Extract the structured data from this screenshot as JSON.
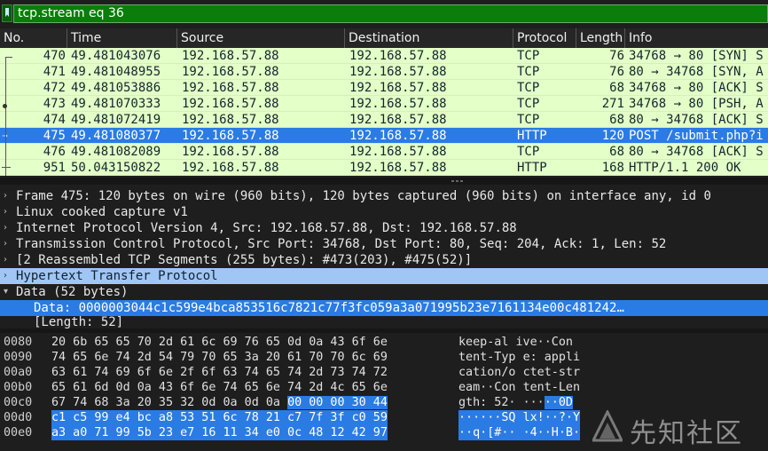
{
  "filter": {
    "value": "tcp.stream eq 36"
  },
  "columns": [
    "No.",
    "Time",
    "Source",
    "Destination",
    "Protocol",
    "Length",
    "Info"
  ],
  "packets": [
    {
      "no": "470",
      "time": "49.481043076",
      "src": "192.168.57.88",
      "dst": "192.168.57.88",
      "proto": "TCP",
      "len": "76",
      "info": "34768 → 80 [SYN] S"
    },
    {
      "no": "471",
      "time": "49.481048955",
      "src": "192.168.57.88",
      "dst": "192.168.57.88",
      "proto": "TCP",
      "len": "76",
      "info": "80 → 34768 [SYN, A"
    },
    {
      "no": "472",
      "time": "49.481053886",
      "src": "192.168.57.88",
      "dst": "192.168.57.88",
      "proto": "TCP",
      "len": "68",
      "info": "34768 → 80 [ACK] S"
    },
    {
      "no": "473",
      "time": "49.481070333",
      "src": "192.168.57.88",
      "dst": "192.168.57.88",
      "proto": "TCP",
      "len": "271",
      "info": "34768 → 80 [PSH, A"
    },
    {
      "no": "474",
      "time": "49.481072419",
      "src": "192.168.57.88",
      "dst": "192.168.57.88",
      "proto": "TCP",
      "len": "68",
      "info": "80 → 34768 [ACK] S"
    },
    {
      "no": "475",
      "time": "49.481080377",
      "src": "192.168.57.88",
      "dst": "192.168.57.88",
      "proto": "HTTP",
      "len": "120",
      "info": "POST /submit.php?i"
    },
    {
      "no": "476",
      "time": "49.481082089",
      "src": "192.168.57.88",
      "dst": "192.168.57.88",
      "proto": "TCP",
      "len": "68",
      "info": "80 → 34768 [ACK] S"
    },
    {
      "no": "951",
      "time": "50.043150822",
      "src": "192.168.57.88",
      "dst": "192.168.57.88",
      "proto": "HTTP",
      "len": "168",
      "info": "HTTP/1.1 200 OK"
    }
  ],
  "details": [
    {
      "arrow": "›",
      "text": "Frame 475: 120 bytes on wire (960 bits), 120 bytes captured (960 bits) on interface any, id 0"
    },
    {
      "arrow": "›",
      "text": "Linux cooked capture v1"
    },
    {
      "arrow": "›",
      "text": "Internet Protocol Version 4, Src: 192.168.57.88, Dst: 192.168.57.88"
    },
    {
      "arrow": "›",
      "text": "Transmission Control Protocol, Src Port: 34768, Dst Port: 80, Seq: 204, Ack: 1, Len: 52"
    },
    {
      "arrow": "›",
      "text": "[2 Reassembled TCP Segments (255 bytes): #473(203), #475(52)]"
    },
    {
      "arrow": "›",
      "text": "Hypertext Transfer Protocol"
    },
    {
      "arrow": "▾",
      "text": "Data (52 bytes)"
    },
    {
      "arrow": "",
      "text": "Data: 0000003044c1c599e4bca853516c7821c77f3fc059a3a071995b23e7161134e00c481242…"
    },
    {
      "arrow": "",
      "text": "[Length: 52]"
    }
  ],
  "bytes": [
    {
      "off": "0080",
      "hex1": "20 6b 65 65 70 2d 61 6c",
      "hex2": "69 76 65 0d 0a 43 6f 6e",
      "asc1": " keep-al",
      "asc2": "ive··Con"
    },
    {
      "off": "0090",
      "hex1": "74 65 6e 74 2d 54 79 70",
      "hex2": "65 3a 20 61 70 70 6c 69",
      "asc1": "tent-Typ",
      "asc2": "e: appli"
    },
    {
      "off": "00a0",
      "hex1": "63 61 74 69 6f 6e 2f 6f",
      "hex2": "63 74 65 74 2d 73 74 72",
      "asc1": "cation/o",
      "asc2": "ctet-str"
    },
    {
      "off": "00b0",
      "hex1": "65 61 6d 0d 0a 43 6f 6e",
      "hex2": "74 65 6e 74 2d 4c 65 6e",
      "asc1": "eam··Con",
      "asc2": "tent-Len"
    },
    {
      "off": "00c0",
      "hex1": "67 74 68 3a 20 35 32 0d",
      "hex2a": "0a 0d 0a ",
      "hex2b": "00 00 00 30 44",
      "asc1": "gth: 52·",
      "asc2a": "···",
      "asc2b": "··0D"
    },
    {
      "off": "00d0",
      "hex1": "c1 c5 99 e4 bc a8 53 51",
      "hex2": "6c 78 21 c7 7f 3f c0 59",
      "asc1": "······SQ",
      "asc2": "lx!··?·Y"
    },
    {
      "off": "00e0",
      "hex1": "a3 a0 71 99 5b 23 e7 16",
      "hex2": "11 34 e0 0c 48 12 42 97",
      "asc1": "··q·[#··",
      "asc2": "·4··H·B·"
    }
  ],
  "watermark": {
    "text": "先知社区"
  },
  "colors": {
    "filter_bg": "#0a7d0a",
    "row_bg": "#e4ffc7",
    "selected": "#2a7be4",
    "highlight": "#9fc6f5"
  }
}
